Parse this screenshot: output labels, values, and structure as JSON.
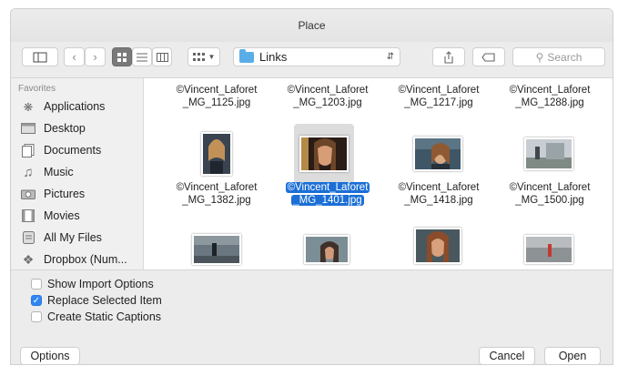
{
  "window": {
    "title": "Place"
  },
  "toolbar": {
    "path_folder": "Links",
    "search_placeholder": "Search"
  },
  "sidebar": {
    "heading": "Favorites",
    "items": [
      {
        "label": "Applications",
        "icon": "applications-icon"
      },
      {
        "label": "Desktop",
        "icon": "desktop-icon"
      },
      {
        "label": "Documents",
        "icon": "documents-icon"
      },
      {
        "label": "Music",
        "icon": "music-icon"
      },
      {
        "label": "Pictures",
        "icon": "pictures-icon"
      },
      {
        "label": "Movies",
        "icon": "movies-icon"
      },
      {
        "label": "All My Files",
        "icon": "all-files-icon"
      },
      {
        "label": "Dropbox (Num...",
        "icon": "dropbox-icon"
      }
    ]
  },
  "files": [
    {
      "line1": "©Vincent_Laforet",
      "line2": "_MG_1125.jpg",
      "selected": false
    },
    {
      "line1": "©Vincent_Laforet",
      "line2": "_MG_1203.jpg",
      "selected": false
    },
    {
      "line1": "©Vincent_Laforet",
      "line2": "_MG_1217.jpg",
      "selected": false
    },
    {
      "line1": "©Vincent_Laforet",
      "line2": "_MG_1288.jpg",
      "selected": false
    },
    {
      "line1": "©Vincent_Laforet",
      "line2": "_MG_1382.jpg",
      "selected": false
    },
    {
      "line1": "©Vincent_Laforet",
      "line2": "_MG_1401.jpg",
      "selected": true
    },
    {
      "line1": "©Vincent_Laforet",
      "line2": "_MG_1418.jpg",
      "selected": false
    },
    {
      "line1": "©Vincent_Laforet",
      "line2": "_MG_1500.jpg",
      "selected": false
    }
  ],
  "options": {
    "show_import": {
      "label": "Show Import Options",
      "checked": false
    },
    "replace_selected": {
      "label": "Replace Selected Item",
      "checked": true
    },
    "static_captions": {
      "label": "Create Static Captions",
      "checked": false
    }
  },
  "buttons": {
    "options": "Options",
    "cancel": "Cancel",
    "open": "Open"
  },
  "colors": {
    "accent": "#1b6fd6",
    "checkbox_on": "#2f86f2"
  }
}
